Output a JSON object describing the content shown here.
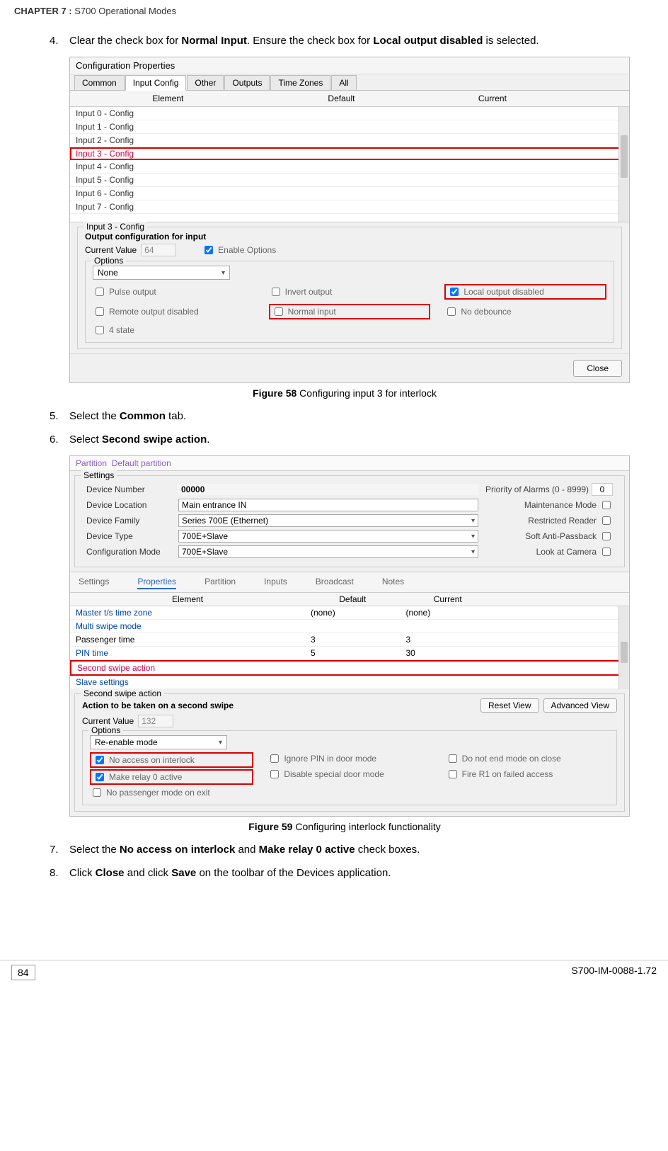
{
  "header": {
    "chapter": "CHAPTER 7 :",
    "title": "S700 Operational Modes"
  },
  "steps": {
    "s4": {
      "num": "4.",
      "text_before": "Clear the check box for ",
      "b1": "Normal Input",
      "text_mid": ". Ensure the check box for ",
      "b2": "Local output disabled",
      "text_after": " is selected."
    },
    "s5": {
      "num": "5.",
      "text": "Select the ",
      "b1": "Common",
      "text2": " tab."
    },
    "s6": {
      "num": "6.",
      "text": "Select ",
      "b1": "Second swipe action",
      "text2": "."
    },
    "s7": {
      "num": "7.",
      "text": "Select the ",
      "b1": "No access on interlock",
      "text_mid": " and ",
      "b2": "Make relay 0 active",
      "text_after": " check boxes."
    },
    "s8": {
      "num": "8.",
      "text": "Click ",
      "b1": "Close",
      "text_mid": " and click ",
      "b2": "Save",
      "text_after": " on the toolbar of the Devices application."
    }
  },
  "captions": {
    "fig58_b": "Figure 58",
    "fig58_t": " Configuring input 3 for interlock",
    "fig59_b": "Figure 59",
    "fig59_t": " Configuring interlock functionality"
  },
  "panel1": {
    "title": "Configuration Properties",
    "tabs": {
      "common": "Common",
      "input_config": "Input Config",
      "other": "Other",
      "outputs": "Outputs",
      "time_zones": "Time Zones",
      "all": "All"
    },
    "headers": {
      "element": "Element",
      "default": "Default",
      "current": "Current"
    },
    "rows": [
      "Input 0 - Config",
      "Input 1 - Config",
      "Input 2 - Config",
      "Input 3 - Config",
      "Input 4 - Config",
      "Input 5 - Config",
      "Input 6 - Config",
      "Input 7 - Config"
    ],
    "section_label": "Input 3 - Config",
    "sub_title": "Output configuration for input",
    "current_value_lbl": "Current Value",
    "current_value": "64",
    "enable_options": "Enable Options",
    "options_lbl": "Options",
    "dropdown": "None",
    "opts": {
      "pulse": "Pulse output",
      "remote_disabled": "Remote output disabled",
      "four_state": "4 state",
      "invert": "Invert output",
      "normal_input": "Normal input",
      "local_disabled": "Local output disabled",
      "no_debounce": "No debounce"
    },
    "close": "Close"
  },
  "panel2": {
    "partition_lbl": "Partition",
    "partition_val": "Default partition",
    "settings_lbl": "Settings",
    "device_number_lbl": "Device Number",
    "device_number": "00000",
    "priority_lbl": "Priority of Alarms (0 - 8999)",
    "priority": "0",
    "device_location_lbl": "Device Location",
    "device_location": "Main entrance IN",
    "maint_mode": "Maintenance Mode",
    "device_family_lbl": "Device Family",
    "device_family": "Series 700E (Ethernet)",
    "restricted": "Restricted Reader",
    "device_type_lbl": "Device Type",
    "device_type": "700E+Slave",
    "anti_passback": "Soft Anti-Passback",
    "config_mode_lbl": "Configuration Mode",
    "config_mode": "700E+Slave",
    "look_camera": "Look at Camera",
    "subtabs": {
      "settings": "Settings",
      "properties": "Properties",
      "partition": "Partition",
      "inputs": "Inputs",
      "broadcast": "Broadcast",
      "notes": "Notes"
    },
    "t_headers": {
      "element": "Element",
      "default": "Default",
      "current": "Current"
    },
    "t_rows": [
      {
        "name": "Master t/s time zone",
        "def": "(none)",
        "cur": "(none)"
      },
      {
        "name": "Multi swipe mode",
        "def": "",
        "cur": ""
      },
      {
        "name": "Passenger time",
        "def": "3",
        "cur": "3"
      },
      {
        "name": "PIN time",
        "def": "5",
        "cur": "30"
      },
      {
        "name": "Second swipe action",
        "def": "",
        "cur": ""
      },
      {
        "name": "Slave settings",
        "def": "",
        "cur": ""
      }
    ],
    "second_swipe_lbl": "Second swipe action",
    "action_lbl": "Action to be taken on a second swipe",
    "reset_view": "Reset View",
    "adv_view": "Advanced View",
    "current_value_lbl": "Current Value",
    "current_value": "132",
    "options_lbl": "Options",
    "dropdown": "Re-enable mode",
    "opts": {
      "no_access": "No access on interlock",
      "make_relay": "Make relay 0 active",
      "no_passenger": "No passenger mode on exit",
      "ignore_pin": "Ignore PIN in door mode",
      "disable_special": "Disable special door mode",
      "do_not_end": "Do not end mode on close",
      "fire_r1": "Fire R1 on failed access"
    }
  },
  "footer": {
    "page": "84",
    "doc": "S700-IM-0088-1.72"
  }
}
